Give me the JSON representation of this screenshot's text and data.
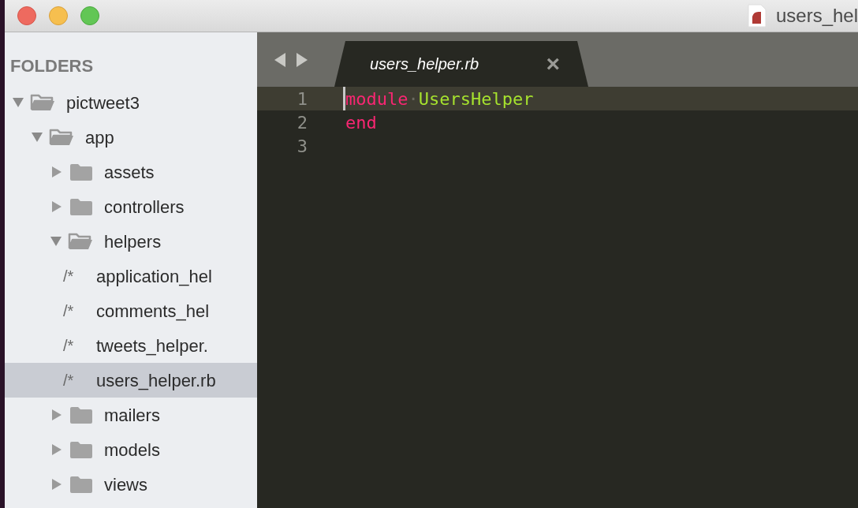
{
  "window": {
    "title": "users_hel"
  },
  "sidebar": {
    "heading": "FOLDERS",
    "tree": [
      {
        "kind": "folder",
        "label": "pictweet3",
        "expanded": true,
        "selected": false,
        "children": [
          {
            "kind": "folder",
            "label": "app",
            "expanded": true,
            "selected": false,
            "children": [
              {
                "kind": "folder",
                "label": "assets",
                "expanded": false,
                "selected": false
              },
              {
                "kind": "folder",
                "label": "controllers",
                "expanded": false,
                "selected": false
              },
              {
                "kind": "folder",
                "label": "helpers",
                "expanded": true,
                "selected": false,
                "children": [
                  {
                    "kind": "file",
                    "glyph": "/*",
                    "label": "application_hel",
                    "selected": false
                  },
                  {
                    "kind": "file",
                    "glyph": "/*",
                    "label": "comments_hel",
                    "selected": false
                  },
                  {
                    "kind": "file",
                    "glyph": "/*",
                    "label": "tweets_helper.",
                    "selected": false
                  },
                  {
                    "kind": "file",
                    "glyph": "/*",
                    "label": "users_helper.rb",
                    "selected": true
                  }
                ]
              },
              {
                "kind": "folder",
                "label": "mailers",
                "expanded": false,
                "selected": false
              },
              {
                "kind": "folder",
                "label": "models",
                "expanded": false,
                "selected": false
              },
              {
                "kind": "folder",
                "label": "views",
                "expanded": false,
                "selected": false
              }
            ]
          }
        ]
      }
    ]
  },
  "tabs": [
    {
      "label": "users_helper.rb",
      "close": "×",
      "selected": true
    }
  ],
  "editor": {
    "lines": [
      {
        "number": "1",
        "current": true,
        "tokens": [
          {
            "kind": "keyword",
            "text": "module"
          },
          {
            "kind": "whitespace",
            "text": "·"
          },
          {
            "kind": "constant",
            "text": "UsersHelper"
          }
        ]
      },
      {
        "number": "2",
        "current": false,
        "tokens": [
          {
            "kind": "keyword",
            "text": "end"
          }
        ]
      },
      {
        "number": "3",
        "current": false
      }
    ]
  }
}
